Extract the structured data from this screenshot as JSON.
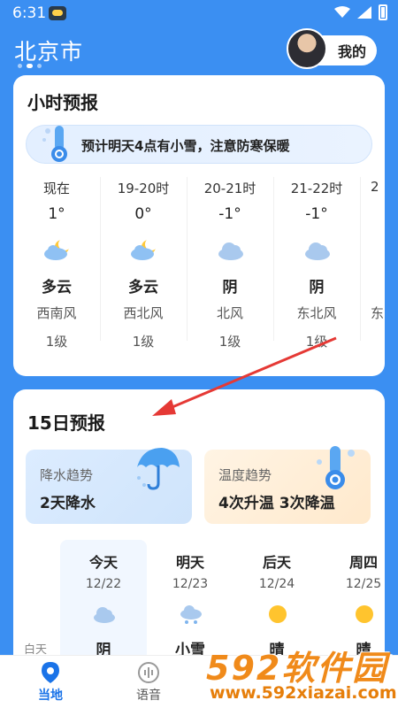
{
  "status_bar": {
    "time": "6:31"
  },
  "header": {
    "city": "北京市",
    "mine_label": "我的"
  },
  "hourly": {
    "title": "小时预报",
    "alert": "预计明天4点有小雪，注意防寒保暖",
    "items": [
      {
        "time": "现在",
        "temp": "1°",
        "icon": "partly-cloudy-night-icon",
        "desc": "多云",
        "wind": "西南风",
        "level": "1级"
      },
      {
        "time": "19-20时",
        "temp": "0°",
        "icon": "partly-cloudy-night-icon",
        "desc": "多云",
        "wind": "西北风",
        "level": "1级"
      },
      {
        "time": "20-21时",
        "temp": "-1°",
        "icon": "cloud-icon",
        "desc": "阴",
        "wind": "北风",
        "level": "1级"
      },
      {
        "time": "21-22时",
        "temp": "-1°",
        "icon": "cloud-icon",
        "desc": "阴",
        "wind": "东北风",
        "level": "1级"
      },
      {
        "time": "2",
        "temp": "",
        "icon": "",
        "desc": "",
        "wind": "东",
        "level": ""
      }
    ]
  },
  "daily": {
    "title": "15日预报",
    "rain_trend": {
      "label": "降水趋势",
      "value": "2天降水"
    },
    "temp_trend": {
      "label": "温度趋势",
      "value": "4次升温 3次降温"
    },
    "day_label": "白天",
    "days": [
      {
        "name": "今天",
        "date": "12/22",
        "icon": "cloud-icon",
        "desc": "阴"
      },
      {
        "name": "明天",
        "date": "12/23",
        "icon": "snow-icon",
        "desc": "小雪"
      },
      {
        "name": "后天",
        "date": "12/24",
        "icon": "sun-icon",
        "desc": "晴"
      },
      {
        "name": "周四",
        "date": "12/25",
        "icon": "sun-icon",
        "desc": "晴"
      }
    ]
  },
  "nav": {
    "local": "当地",
    "voice": "语音"
  },
  "watermark": {
    "brand": "592软件园",
    "url": "www.592xiazai.com"
  }
}
